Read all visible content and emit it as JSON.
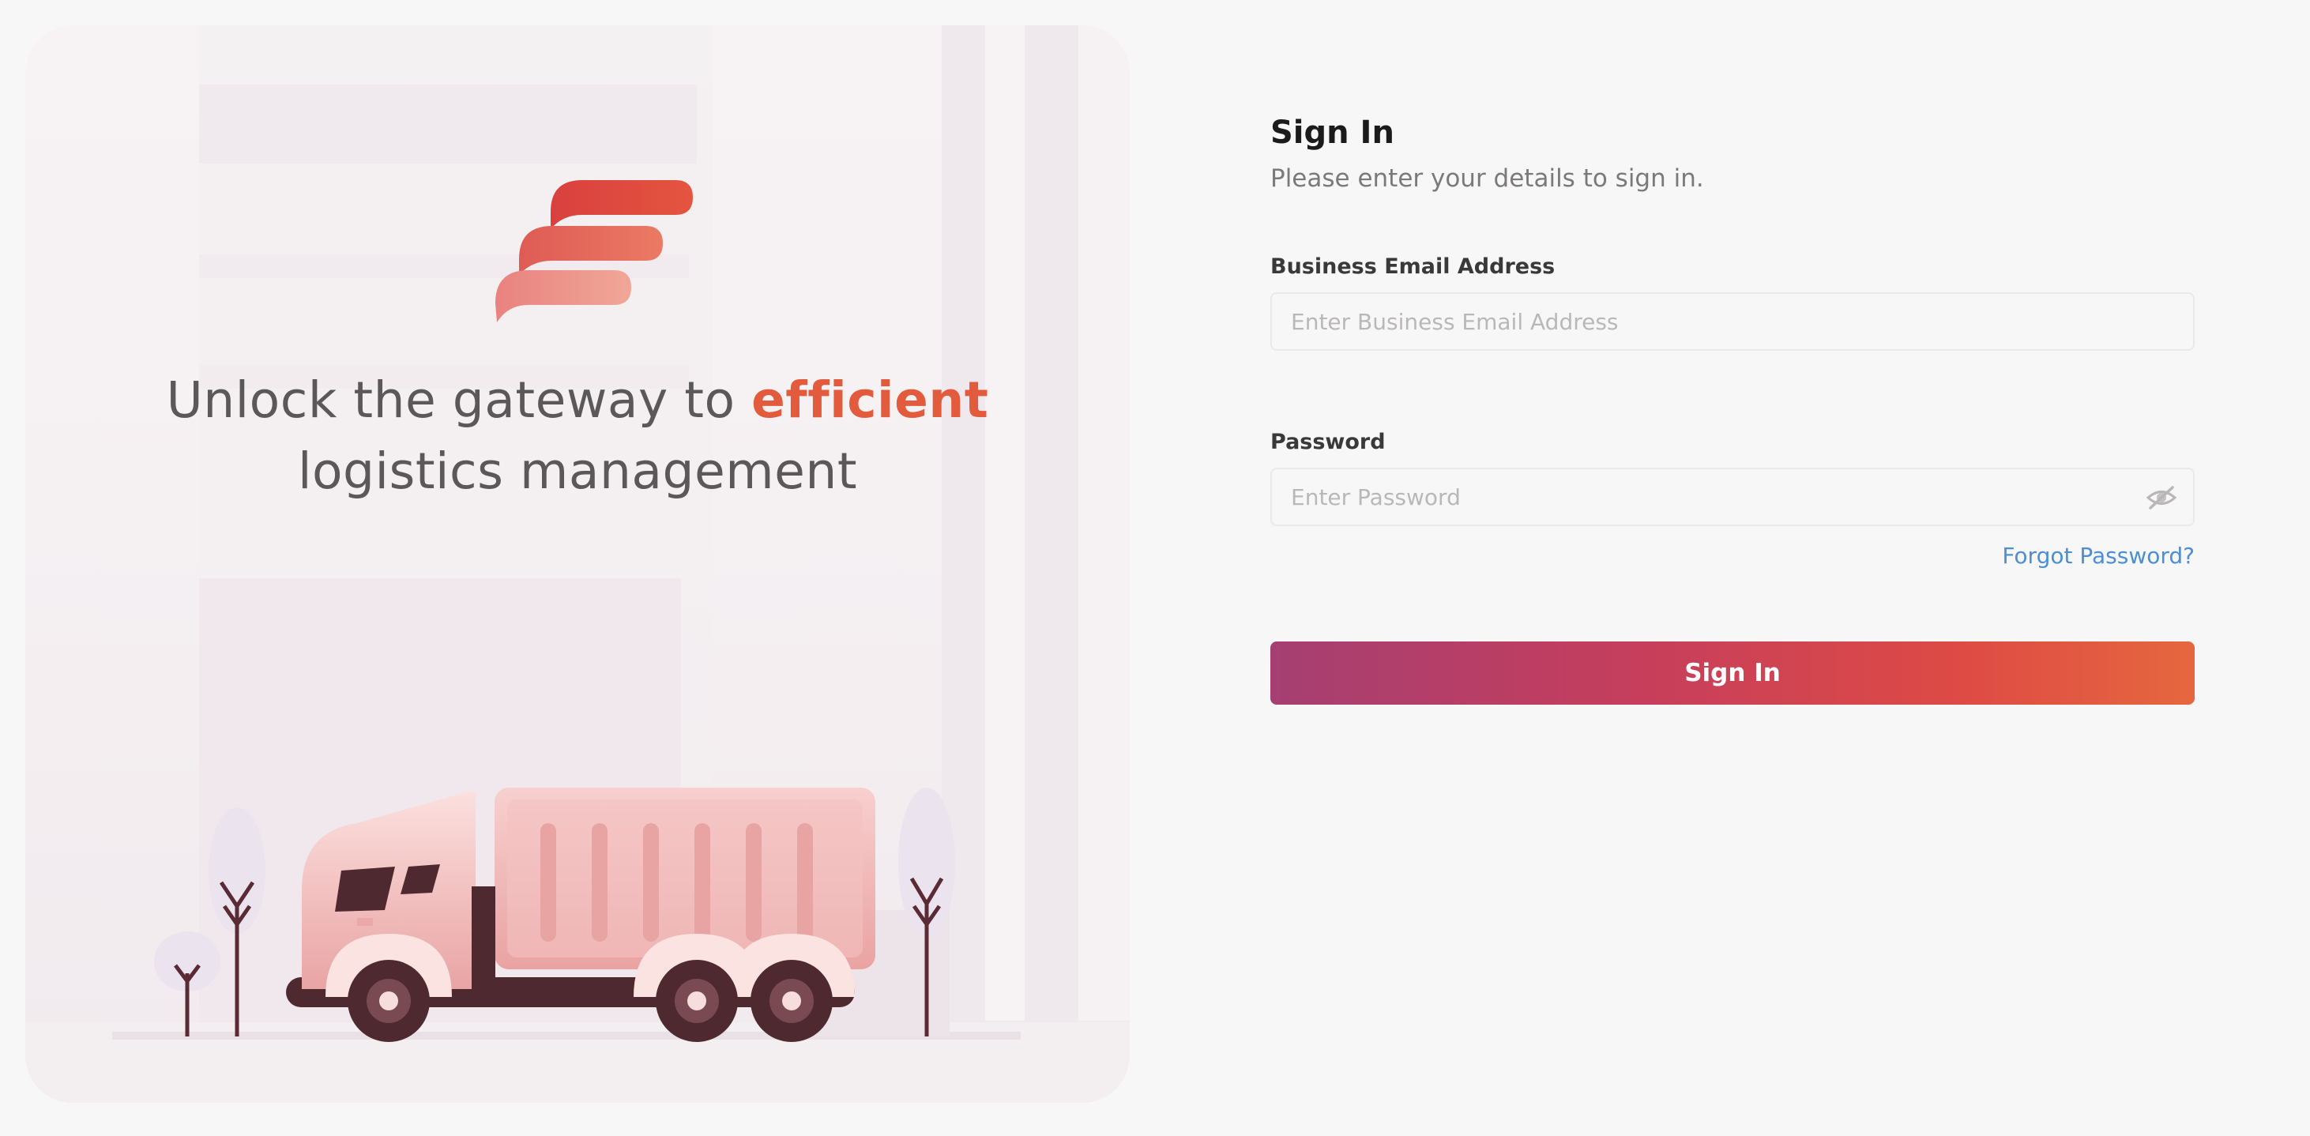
{
  "hero": {
    "tagline_before": "Unlock the gateway to ",
    "tagline_accent": "efficient",
    "tagline_after": " logistics management",
    "accent_color": "#e35b3d"
  },
  "signin": {
    "title": "Sign In",
    "subtitle": "Please enter your details to sign in.",
    "email": {
      "label": "Business Email Address",
      "placeholder": "Enter Business Email Address",
      "value": ""
    },
    "password": {
      "label": "Password",
      "placeholder": "Enter Password",
      "value": "",
      "toggle_icon": "eye-off-icon"
    },
    "forgot_password_label": "Forgot Password?",
    "submit_label": "Sign In"
  },
  "colors": {
    "page_background": "#f8f7f8",
    "link": "#4a8fd8",
    "button_gradient_start": "#a53f72",
    "button_gradient_end": "#e6673f"
  }
}
